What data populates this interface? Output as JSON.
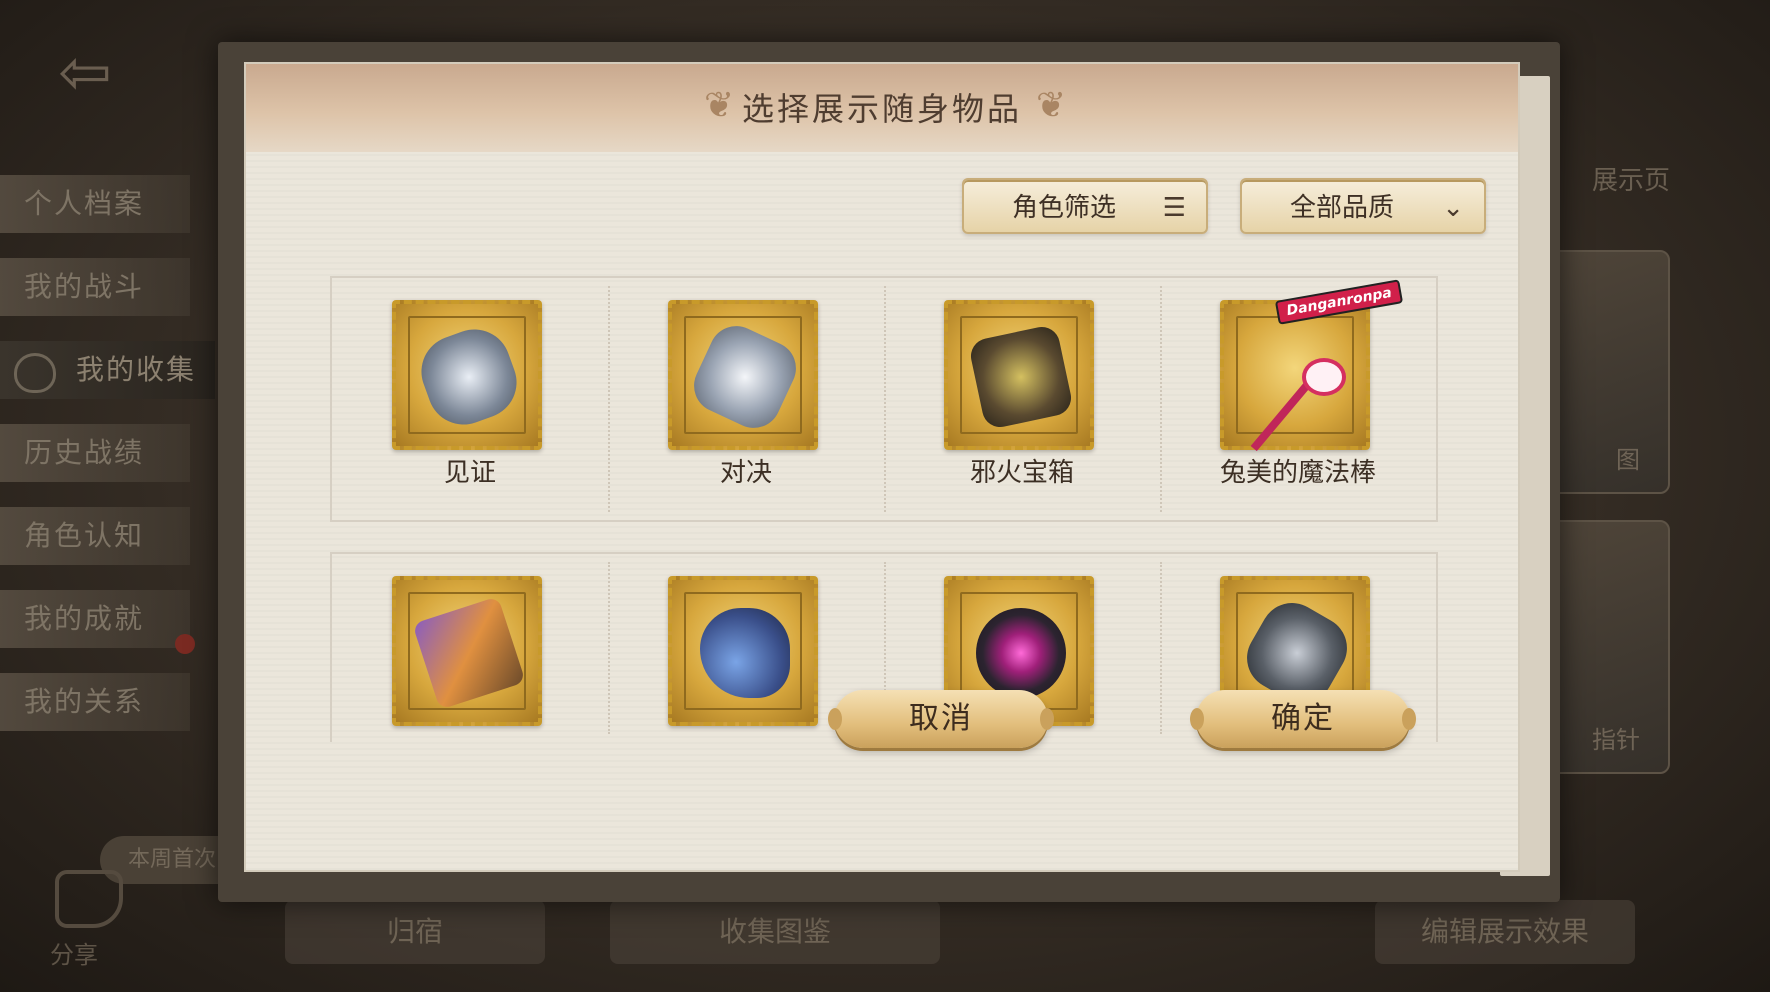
{
  "background": {
    "side_menu": [
      {
        "label": "个人档案"
      },
      {
        "label": "我的战斗"
      },
      {
        "label": "我的收集",
        "active": true
      },
      {
        "label": "历史战绩"
      },
      {
        "label": "角色认知"
      },
      {
        "label": "我的成就"
      },
      {
        "label": "我的关系"
      }
    ],
    "week_first": "本周首次",
    "share": "分享",
    "bottom_tabs": [
      "归宿",
      "收集图鉴",
      "编辑展示效果"
    ],
    "right_labels": [
      "展示页",
      "图",
      "指针"
    ]
  },
  "modal": {
    "title": "选择展示随身物品",
    "filter_character": "角色筛选",
    "filter_quality": "全部品质",
    "items_row1": [
      {
        "name": "见证",
        "icon": "witness-relic-icon"
      },
      {
        "name": "对决",
        "icon": "duel-relic-icon"
      },
      {
        "name": "邪火宝箱",
        "icon": "evil-fire-chest-icon"
      },
      {
        "name": "兔美的魔法棒",
        "icon": "magic-wand-icon",
        "badge": "Danganronpa"
      }
    ],
    "items_row2": [
      {
        "name": "",
        "icon": "butterfly-book-icon"
      },
      {
        "name": "",
        "icon": "blue-gourd-icon"
      },
      {
        "name": "",
        "icon": "pink-eye-icon"
      },
      {
        "name": "",
        "icon": "silver-chain-icon"
      }
    ],
    "cancel": "取消",
    "confirm": "确定"
  }
}
